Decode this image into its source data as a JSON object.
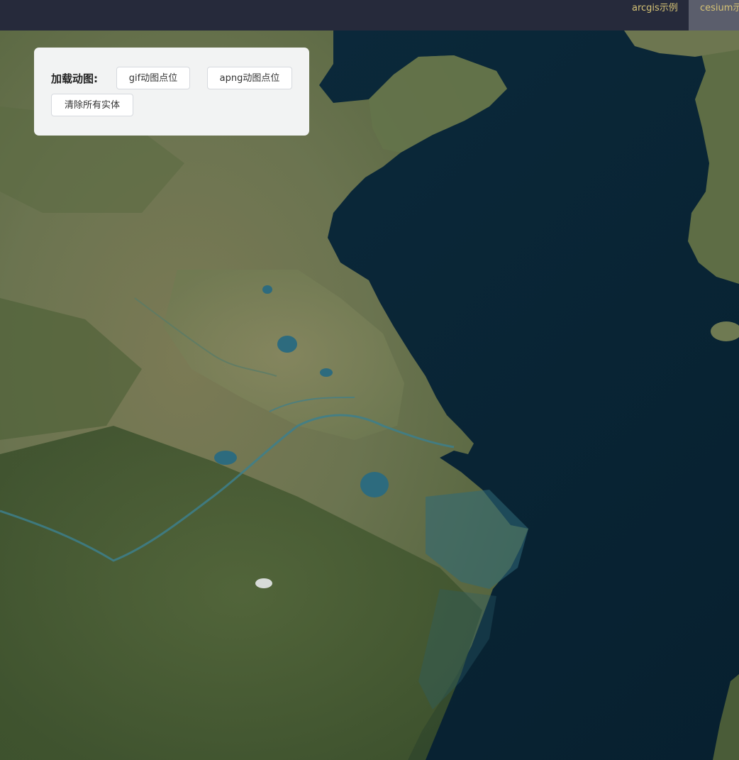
{
  "nav": {
    "tabs": [
      {
        "label": "arcgis示例",
        "active": false
      },
      {
        "label": "cesium示例",
        "active": true
      }
    ]
  },
  "panel": {
    "label": "加载动图:",
    "gif_button": "gif动图点位",
    "apng_button": "apng动图点位",
    "clear_button": "清除所有实体"
  },
  "map": {
    "imagery": "satellite",
    "colors": {
      "sea": "#0a2536",
      "land": "#6e7a52",
      "forest": "#3f5430",
      "shallow": "#2f6a78"
    }
  }
}
